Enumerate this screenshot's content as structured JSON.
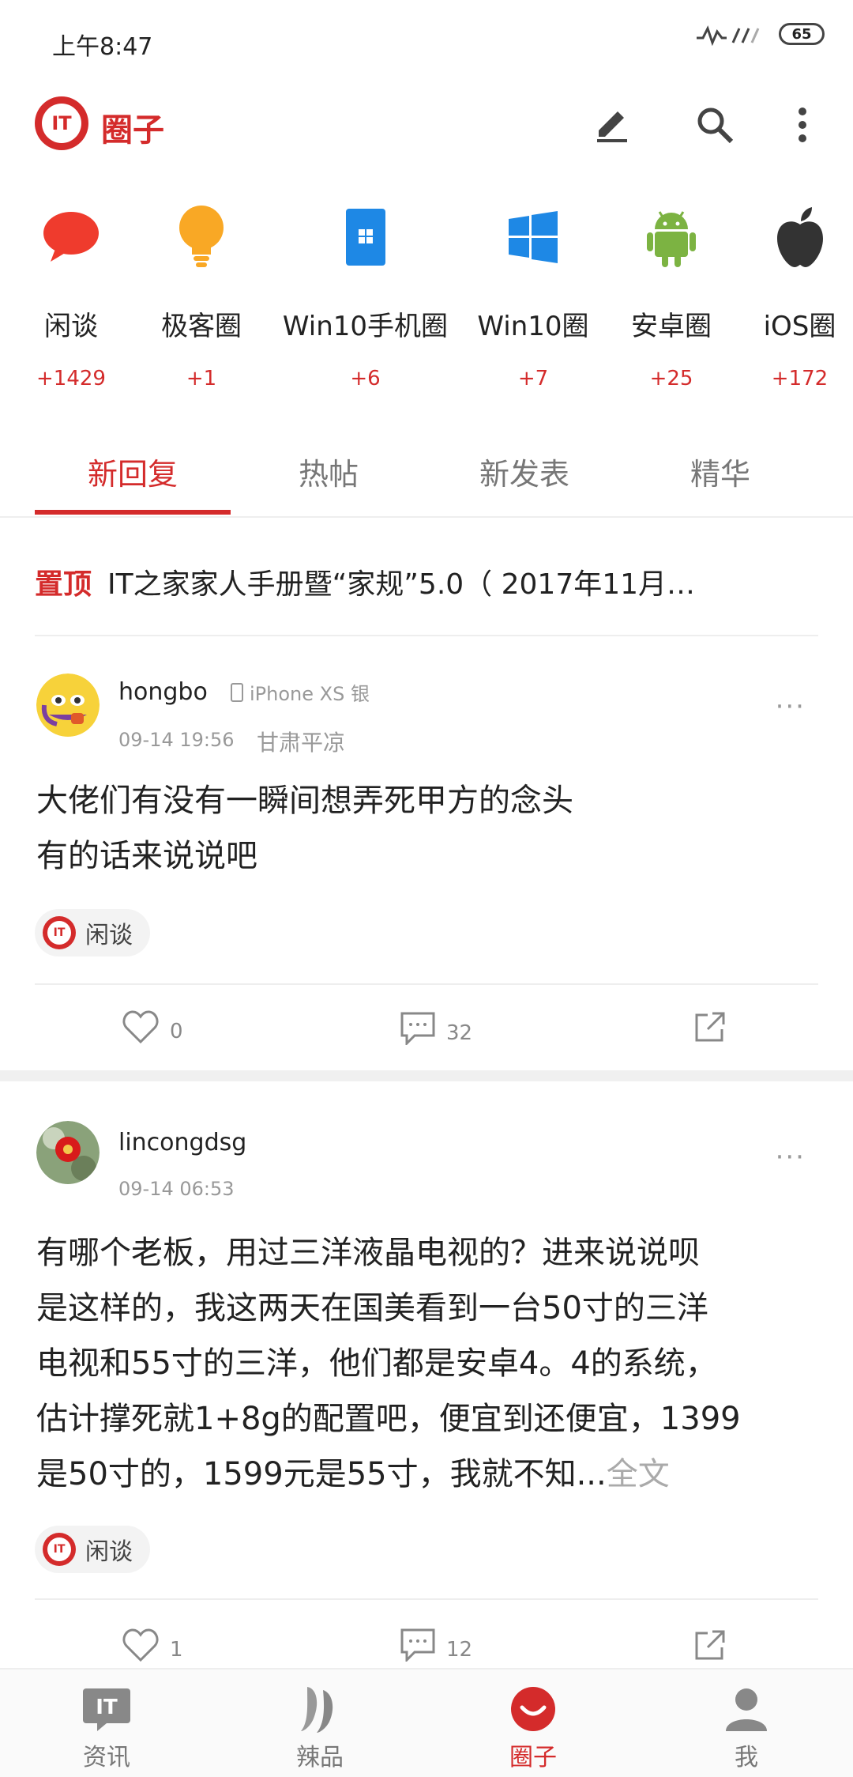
{
  "status": {
    "time": "上午8:47",
    "battery": "65"
  },
  "app": {
    "title": "圈子"
  },
  "circles": [
    {
      "name": "闲谈",
      "count": "+1429",
      "icon": "speech-bubble-icon"
    },
    {
      "name": "极客圈",
      "count": "+1",
      "icon": "lightbulb-icon"
    },
    {
      "name": "Win10手机圈",
      "count": "+6",
      "icon": "windows-phone-icon"
    },
    {
      "name": "Win10圈",
      "count": "+7",
      "icon": "windows-logo-icon"
    },
    {
      "name": "安卓圈",
      "count": "+25",
      "icon": "android-icon"
    },
    {
      "name": "iOS圈",
      "count": "+172",
      "icon": "apple-icon"
    }
  ],
  "tabs": [
    {
      "label": "新回复"
    },
    {
      "label": "热帖"
    },
    {
      "label": "新发表"
    },
    {
      "label": "精华"
    }
  ],
  "pinned": {
    "badge": "置顶",
    "title": "IT之家家人手册暨“家规”5.0（ 2017年11月…"
  },
  "posts": [
    {
      "user": "hongbo",
      "device": "iPhone XS 银",
      "time": "09-14 19:56",
      "location": "甘肃平凉",
      "body_lines": [
        "大佬们有没有一瞬间想弄死甲方的念头",
        "有的话来说说吧"
      ],
      "tag": "闲谈",
      "likes": "0",
      "comments": "32"
    },
    {
      "user": "lincongdsg",
      "time": "09-14 06:53",
      "body_lines": [
        "有哪个老板，用过三洋液晶电视的？进来说说呗",
        "是这样的，我这两天在国美看到一台50寸的三洋",
        "电视和55寸的三洋，他们都是安卓4。4的系统，",
        "估计撑死就1+8g的配置吧，便宜到还便宜，1399",
        "是50寸的，1599元是55寸，我就不知..."
      ],
      "read_more": "全文",
      "tag": "闲谈",
      "likes": "1",
      "comments": "12"
    }
  ],
  "nav": [
    {
      "label": "资讯"
    },
    {
      "label": "辣品"
    },
    {
      "label": "圈子"
    },
    {
      "label": "我"
    }
  ],
  "colors": {
    "accent": "#d42b2b"
  }
}
